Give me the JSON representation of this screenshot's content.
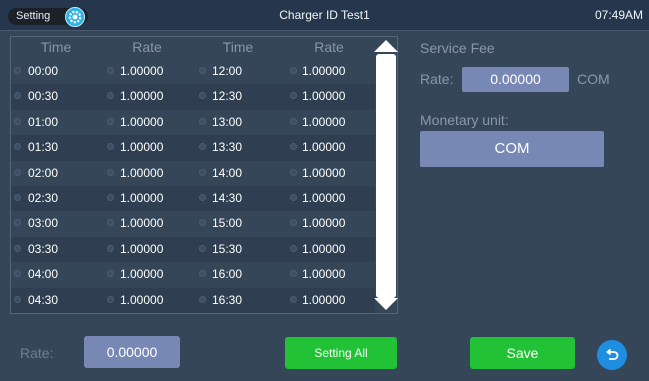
{
  "header": {
    "setting_label": "Setting",
    "title": "Charger ID Test1",
    "clock": "07:49AM"
  },
  "table": {
    "columns": [
      "Time",
      "Rate",
      "Time",
      "Rate"
    ],
    "rows": [
      {
        "time_left": "00:00",
        "rate_left": "1.00000",
        "time_right": "12:00",
        "rate_right": "1.00000"
      },
      {
        "time_left": "00:30",
        "rate_left": "1.00000",
        "time_right": "12:30",
        "rate_right": "1.00000"
      },
      {
        "time_left": "01:00",
        "rate_left": "1.00000",
        "time_right": "13:00",
        "rate_right": "1.00000"
      },
      {
        "time_left": "01:30",
        "rate_left": "1.00000",
        "time_right": "13:30",
        "rate_right": "1.00000"
      },
      {
        "time_left": "02:00",
        "rate_left": "1.00000",
        "time_right": "14:00",
        "rate_right": "1.00000"
      },
      {
        "time_left": "02:30",
        "rate_left": "1.00000",
        "time_right": "14:30",
        "rate_right": "1.00000"
      },
      {
        "time_left": "03:00",
        "rate_left": "1.00000",
        "time_right": "15:00",
        "rate_right": "1.00000"
      },
      {
        "time_left": "03:30",
        "rate_left": "1.00000",
        "time_right": "15:30",
        "rate_right": "1.00000"
      },
      {
        "time_left": "04:00",
        "rate_left": "1.00000",
        "time_right": "16:00",
        "rate_right": "1.00000"
      },
      {
        "time_left": "04:30",
        "rate_left": "1.00000",
        "time_right": "16:30",
        "rate_right": "1.00000"
      }
    ]
  },
  "service_fee": {
    "title": "Service Fee",
    "rate_label": "Rate:",
    "rate_value": "0.00000",
    "rate_unit": "COM",
    "monetary_label": "Monetary unit:",
    "monetary_value": "COM"
  },
  "bottom": {
    "rate_label": "Rate:",
    "rate_value": "0.00000",
    "setting_all_label": "Setting All",
    "save_label": "Save"
  },
  "icons": {
    "gear": "gear-icon",
    "back": "back-arrow-icon",
    "scroll_up": "scroll-up-arrow-icon",
    "scroll_down": "scroll-down-arrow-icon"
  },
  "colors": {
    "background": "#344657",
    "header": "#26374d",
    "field": "#7788b5",
    "green_button": "#21c235",
    "back_button": "#1e8fe0",
    "gear": "#2bb3e6"
  }
}
